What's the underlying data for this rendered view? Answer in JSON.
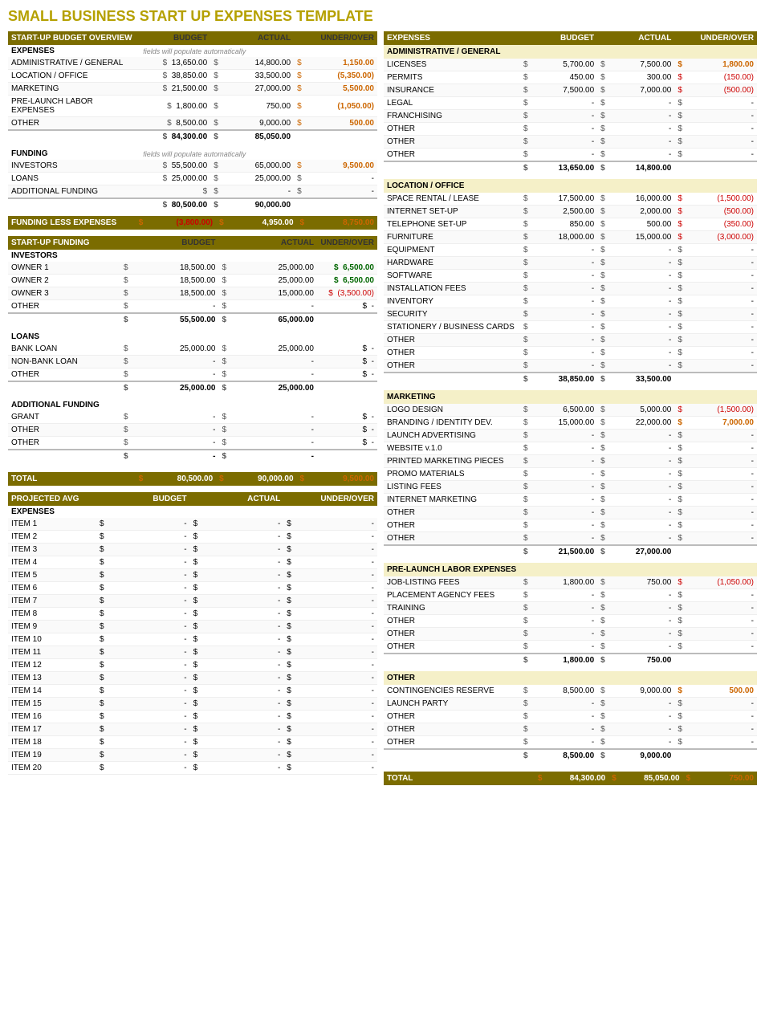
{
  "title": "SMALL BUSINESS START UP EXPENSES TEMPLATE",
  "left": {
    "startup_budget": {
      "header": "START-UP BUDGET OVERVIEW",
      "col_budget": "BUDGET",
      "col_actual": "ACTUAL",
      "col_under": "UNDER/OVER",
      "auto_note": "fields will populate automatically",
      "expenses_label": "EXPENSES",
      "expense_rows": [
        {
          "label": "ADMINISTRATIVE / GENERAL",
          "budget": "13,650.00",
          "actual": "14,800.00",
          "under": "1,150.00",
          "under_class": "orange-val"
        },
        {
          "label": "LOCATION / OFFICE",
          "budget": "38,850.00",
          "actual": "33,500.00",
          "under": "(5,350.00)",
          "under_class": "negative"
        },
        {
          "label": "MARKETING",
          "budget": "21,500.00",
          "actual": "27,000.00",
          "under": "5,500.00",
          "under_class": "orange-val"
        },
        {
          "label": "PRE-LAUNCH LABOR EXPENSES",
          "budget": "1,800.00",
          "actual": "750.00",
          "under": "(1,050.00)",
          "under_class": "negative"
        },
        {
          "label": "OTHER",
          "budget": "8,500.00",
          "actual": "9,000.00",
          "under": "500.00",
          "under_class": "orange-val"
        }
      ],
      "expense_total": {
        "budget": "84,300.00",
        "actual": "85,050.00"
      },
      "funding_label": "FUNDING",
      "funding_auto": "fields will populate automatically",
      "funding_rows": [
        {
          "label": "INVESTORS",
          "budget": "55,500.00",
          "actual": "65,000.00",
          "under": "9,500.00",
          "under_class": "positive"
        },
        {
          "label": "LOANS",
          "budget": "25,000.00",
          "actual": "25,000.00",
          "under": "-",
          "under_class": ""
        },
        {
          "label": "ADDITIONAL FUNDING",
          "budget": "-",
          "actual": "-",
          "under": "-",
          "under_class": ""
        }
      ],
      "funding_total": {
        "budget": "80,500.00",
        "actual": "90,000.00"
      },
      "funding_less_label": "FUNDING LESS EXPENSES",
      "funding_less_budget": "(3,800.00)",
      "funding_less_actual": "4,950.00",
      "funding_less_under": "8,750.00"
    },
    "startup_funding": {
      "header": "START-UP FUNDING",
      "col_budget": "BUDGET",
      "col_actual": "ACTUAL",
      "col_under": "UNDER/OVER",
      "investors_label": "INVESTORS",
      "investor_rows": [
        {
          "label": "OWNER 1",
          "budget": "18,500.00",
          "actual": "25,000.00",
          "under": "6,500.00",
          "under_class": "positive"
        },
        {
          "label": "OWNER 2",
          "budget": "18,500.00",
          "actual": "25,000.00",
          "under": "6,500.00",
          "under_class": "positive"
        },
        {
          "label": "OWNER 3",
          "budget": "18,500.00",
          "actual": "15,000.00",
          "under": "(3,500.00)",
          "under_class": "negative"
        },
        {
          "label": "OTHER",
          "budget": "-",
          "actual": "-",
          "under": "-",
          "under_class": ""
        }
      ],
      "investors_total": {
        "budget": "55,500.00",
        "actual": "65,000.00"
      },
      "loans_label": "LOANS",
      "loan_rows": [
        {
          "label": "BANK LOAN",
          "budget": "25,000.00",
          "actual": "25,000.00",
          "under": "-",
          "under_class": ""
        },
        {
          "label": "NON-BANK LOAN",
          "budget": "-",
          "actual": "-",
          "under": "-",
          "under_class": ""
        },
        {
          "label": "OTHER",
          "budget": "-",
          "actual": "-",
          "under": "-",
          "under_class": ""
        }
      ],
      "loans_total": {
        "budget": "25,000.00",
        "actual": "25,000.00"
      },
      "additional_label": "ADDITIONAL FUNDING",
      "additional_rows": [
        {
          "label": "GRANT",
          "budget": "-",
          "actual": "-",
          "under": "-",
          "under_class": ""
        },
        {
          "label": "OTHER",
          "budget": "-",
          "actual": "-",
          "under": "-",
          "under_class": ""
        },
        {
          "label": "OTHER",
          "budget": "-",
          "actual": "-",
          "under": "-",
          "under_class": ""
        }
      ],
      "additional_total": {
        "budget": "-",
        "actual": "-"
      },
      "total_label": "TOTAL",
      "total_budget": "80,500.00",
      "total_actual": "90,000.00",
      "total_under": "9,500.00"
    },
    "projected": {
      "header": "PROJECTED AVG",
      "col_budget": "BUDGET",
      "col_actual": "ACTUAL",
      "col_under": "UNDER/OVER",
      "expenses_label": "EXPENSES",
      "items": [
        "ITEM 1",
        "ITEM 2",
        "ITEM 3",
        "ITEM 4",
        "ITEM 5",
        "ITEM 6",
        "ITEM 7",
        "ITEM 8",
        "ITEM 9",
        "ITEM 10",
        "ITEM 11",
        "ITEM 12",
        "ITEM 13",
        "ITEM 14",
        "ITEM 15",
        "ITEM 16",
        "ITEM 17",
        "ITEM 18",
        "ITEM 19",
        "ITEM 20"
      ]
    }
  },
  "right": {
    "header": "EXPENSES",
    "col_budget": "BUDGET",
    "col_actual": "ACTUAL",
    "col_under": "UNDER/OVER",
    "admin_label": "ADMINISTRATIVE / GENERAL",
    "admin_rows": [
      {
        "label": "LICENSES",
        "budget": "5,700.00",
        "actual": "7,500.00",
        "under": "1,800.00",
        "under_class": "underover-positive"
      },
      {
        "label": "PERMITS",
        "budget": "450.00",
        "actual": "300.00",
        "under": "(150.00)",
        "under_class": "underover-negative"
      },
      {
        "label": "INSURANCE",
        "budget": "7,500.00",
        "actual": "7,000.00",
        "under": "(500.00)",
        "under_class": "underover-negative"
      },
      {
        "label": "LEGAL",
        "budget": "-",
        "actual": "-",
        "under": "-",
        "under_class": ""
      },
      {
        "label": "FRANCHISING",
        "budget": "-",
        "actual": "-",
        "under": "-",
        "under_class": ""
      },
      {
        "label": "OTHER",
        "budget": "-",
        "actual": "-",
        "under": "-",
        "under_class": ""
      },
      {
        "label": "OTHER",
        "budget": "-",
        "actual": "-",
        "under": "-",
        "under_class": ""
      },
      {
        "label": "OTHER",
        "budget": "-",
        "actual": "-",
        "under": "-",
        "under_class": ""
      }
    ],
    "admin_total": {
      "budget": "13,650.00",
      "actual": "14,800.00"
    },
    "location_label": "LOCATION / OFFICE",
    "location_rows": [
      {
        "label": "SPACE RENTAL / LEASE",
        "budget": "17,500.00",
        "actual": "16,000.00",
        "under": "(1,500.00)",
        "under_class": "underover-negative"
      },
      {
        "label": "INTERNET SET-UP",
        "budget": "2,500.00",
        "actual": "2,000.00",
        "under": "(500.00)",
        "under_class": "underover-negative"
      },
      {
        "label": "TELEPHONE SET-UP",
        "budget": "850.00",
        "actual": "500.00",
        "under": "(350.00)",
        "under_class": "underover-negative"
      },
      {
        "label": "FURNITURE",
        "budget": "18,000.00",
        "actual": "15,000.00",
        "under": "(3,000.00)",
        "under_class": "underover-negative"
      },
      {
        "label": "EQUIPMENT",
        "budget": "-",
        "actual": "-",
        "under": "-",
        "under_class": ""
      },
      {
        "label": "HARDWARE",
        "budget": "-",
        "actual": "-",
        "under": "-",
        "under_class": ""
      },
      {
        "label": "SOFTWARE",
        "budget": "-",
        "actual": "-",
        "under": "-",
        "under_class": ""
      },
      {
        "label": "INSTALLATION FEES",
        "budget": "-",
        "actual": "-",
        "under": "-",
        "under_class": ""
      },
      {
        "label": "INVENTORY",
        "budget": "-",
        "actual": "-",
        "under": "-",
        "under_class": ""
      },
      {
        "label": "SECURITY",
        "budget": "-",
        "actual": "-",
        "under": "-",
        "under_class": ""
      },
      {
        "label": "STATIONERY / BUSINESS CARDS",
        "budget": "-",
        "actual": "-",
        "under": "-",
        "under_class": ""
      },
      {
        "label": "OTHER",
        "budget": "-",
        "actual": "-",
        "under": "-",
        "under_class": ""
      },
      {
        "label": "OTHER",
        "budget": "-",
        "actual": "-",
        "under": "-",
        "under_class": ""
      },
      {
        "label": "OTHER",
        "budget": "-",
        "actual": "-",
        "under": "-",
        "under_class": ""
      }
    ],
    "location_total": {
      "budget": "38,850.00",
      "actual": "33,500.00"
    },
    "marketing_label": "MARKETING",
    "marketing_rows": [
      {
        "label": "LOGO DESIGN",
        "budget": "6,500.00",
        "actual": "5,000.00",
        "under": "(1,500.00)",
        "under_class": "underover-negative"
      },
      {
        "label": "BRANDING / IDENTITY DEV.",
        "budget": "15,000.00",
        "actual": "22,000.00",
        "under": "7,000.00",
        "under_class": "underover-positive"
      },
      {
        "label": "LAUNCH ADVERTISING",
        "budget": "-",
        "actual": "-",
        "under": "-",
        "under_class": ""
      },
      {
        "label": "WEBSITE v.1.0",
        "budget": "-",
        "actual": "-",
        "under": "-",
        "under_class": ""
      },
      {
        "label": "PRINTED MARKETING PIECES",
        "budget": "-",
        "actual": "-",
        "under": "-",
        "under_class": ""
      },
      {
        "label": "PROMO MATERIALS",
        "budget": "-",
        "actual": "-",
        "under": "-",
        "under_class": ""
      },
      {
        "label": "LISTING FEES",
        "budget": "-",
        "actual": "-",
        "under": "-",
        "under_class": ""
      },
      {
        "label": "INTERNET MARKETING",
        "budget": "-",
        "actual": "-",
        "under": "-",
        "under_class": ""
      },
      {
        "label": "OTHER",
        "budget": "-",
        "actual": "-",
        "under": "-",
        "under_class": ""
      },
      {
        "label": "OTHER",
        "budget": "-",
        "actual": "-",
        "under": "-",
        "under_class": ""
      },
      {
        "label": "OTHER",
        "budget": "-",
        "actual": "-",
        "under": "-",
        "under_class": ""
      }
    ],
    "marketing_total": {
      "budget": "21,500.00",
      "actual": "27,000.00"
    },
    "prelaunch_label": "PRE-LAUNCH LABOR EXPENSES",
    "prelaunch_rows": [
      {
        "label": "JOB-LISTING FEES",
        "budget": "1,800.00",
        "actual": "750.00",
        "under": "(1,050.00)",
        "under_class": "underover-negative"
      },
      {
        "label": "PLACEMENT AGENCY FEES",
        "budget": "-",
        "actual": "-",
        "under": "-",
        "under_class": ""
      },
      {
        "label": "TRAINING",
        "budget": "-",
        "actual": "-",
        "under": "-",
        "under_class": ""
      },
      {
        "label": "OTHER",
        "budget": "-",
        "actual": "-",
        "under": "-",
        "under_class": ""
      },
      {
        "label": "OTHER",
        "budget": "-",
        "actual": "-",
        "under": "-",
        "under_class": ""
      },
      {
        "label": "OTHER",
        "budget": "-",
        "actual": "-",
        "under": "-",
        "under_class": ""
      }
    ],
    "prelaunch_total": {
      "budget": "1,800.00",
      "actual": "750.00"
    },
    "other_label": "OTHER",
    "other_rows": [
      {
        "label": "CONTINGENCIES RESERVE",
        "budget": "8,500.00",
        "actual": "9,000.00",
        "under": "500.00",
        "under_class": "underover-positive"
      },
      {
        "label": "LAUNCH PARTY",
        "budget": "-",
        "actual": "-",
        "under": "-",
        "under_class": ""
      },
      {
        "label": "OTHER",
        "budget": "-",
        "actual": "-",
        "under": "-",
        "under_class": ""
      },
      {
        "label": "OTHER",
        "budget": "-",
        "actual": "-",
        "under": "-",
        "under_class": ""
      },
      {
        "label": "OTHER",
        "budget": "-",
        "actual": "-",
        "under": "-",
        "under_class": ""
      }
    ],
    "other_total": {
      "budget": "8,500.00",
      "actual": "9,000.00"
    },
    "total_label": "TOTAL",
    "total_budget": "84,300.00",
    "total_actual": "85,050.00",
    "total_under": "750.00"
  }
}
